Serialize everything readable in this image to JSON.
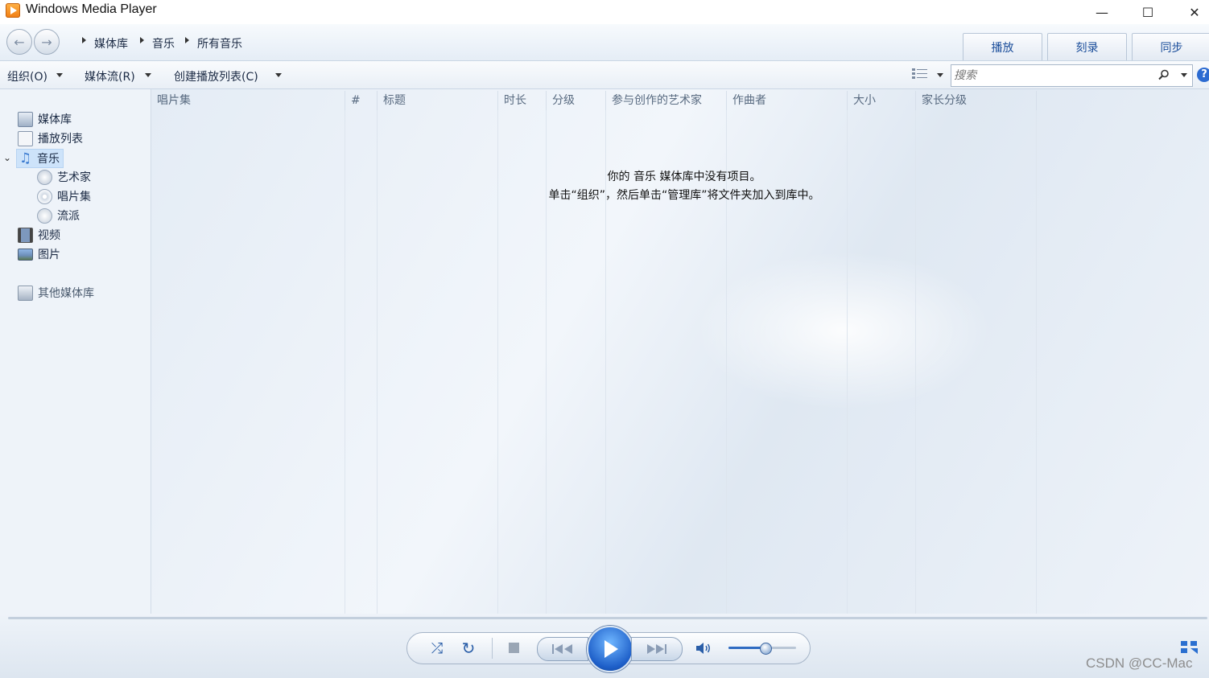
{
  "window": {
    "title": "Windows Media Player",
    "minimize": "—",
    "maximize": "☐",
    "close": "✕"
  },
  "breadcrumb": [
    "媒体库",
    "音乐",
    "所有音乐"
  ],
  "tabs": [
    {
      "label": "播放"
    },
    {
      "label": "刻录"
    },
    {
      "label": "同步"
    }
  ],
  "toolbar": {
    "organize": "组织(O)",
    "stream": "媒体流(R)",
    "create_playlist": "创建播放列表(C)"
  },
  "search": {
    "placeholder": "搜索"
  },
  "help": "?",
  "sidebar": {
    "items": [
      {
        "label": "媒体库",
        "icon": "library-icon"
      },
      {
        "label": "播放列表",
        "icon": "playlist-icon"
      },
      {
        "label": "音乐",
        "icon": "music-icon",
        "selected": true,
        "expanded": true
      },
      {
        "label": "艺术家",
        "icon": "artist-icon"
      },
      {
        "label": "唱片集",
        "icon": "album-icon"
      },
      {
        "label": "流派",
        "icon": "genre-icon"
      },
      {
        "label": "视频",
        "icon": "video-icon"
      },
      {
        "label": "图片",
        "icon": "picture-icon"
      }
    ],
    "other_libraries": "其他媒体库"
  },
  "columns": [
    "唱片集",
    "#",
    "标题",
    "时长",
    "分级",
    "参与创作的艺术家",
    "作曲者",
    "大小",
    "家长分级"
  ],
  "empty_message": {
    "line1": "你的 音乐 媒体库中没有项目。",
    "line2": "单击“组织”，然后单击“管理库”将文件夹加入到库中。"
  },
  "player": {
    "volume": 0.55
  },
  "watermark": "CSDN @CC-Mac",
  "colors": {
    "accent": "#2c6bd1",
    "tab_text": "#1a4d9a",
    "selected_bg": "#cde3fa"
  }
}
